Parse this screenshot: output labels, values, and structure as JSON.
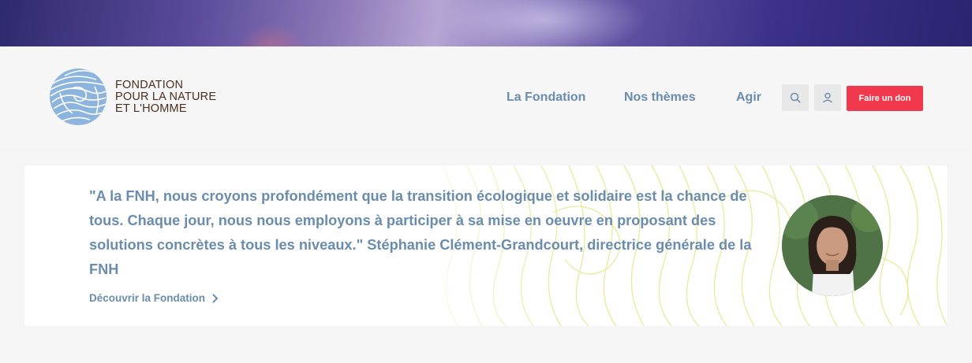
{
  "logo": {
    "line1": "FONDATION",
    "line2": "POUR LA NATURE",
    "line3": "ET L'HOMME"
  },
  "nav": {
    "items": [
      {
        "label": "La Fondation"
      },
      {
        "label": "Nos thèmes"
      },
      {
        "label": "Agir"
      }
    ],
    "search_icon": "search-icon",
    "account_icon": "user-icon",
    "donate_label": "Faire un don"
  },
  "quote_card": {
    "text": "\"A la FNH, nous croyons profondément que la transition écologique et solidaire est la chance de tous. Chaque jour, nous nous employons à participer à sa mise en oeuvre en proposant des solutions concrètes à tous les niveaux.\" Stéphanie Clément-Grandcourt, directrice générale de la FNH",
    "link_label": "Découvrir la Fondation",
    "link_icon": "chevron-right-icon"
  },
  "colors": {
    "accent_blue": "#6a8cad",
    "donate_red": "#f1394d",
    "logo_brown": "#4a2e1e",
    "pattern_yellow": "#e8ea9a"
  }
}
